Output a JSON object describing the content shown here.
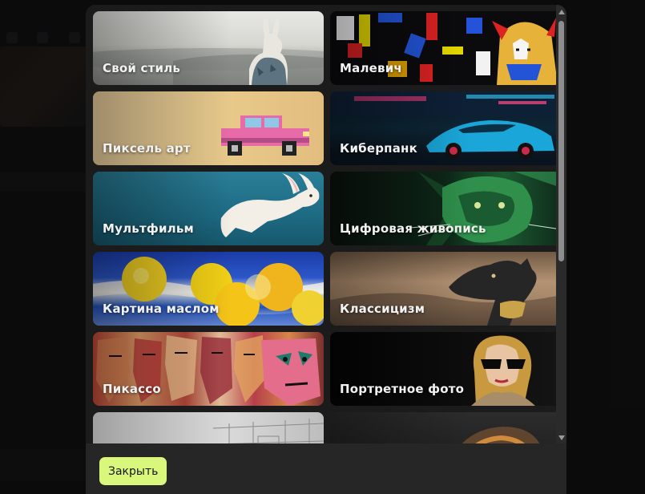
{
  "modal": {
    "styles": [
      {
        "label": "Свой стиль",
        "art": "own"
      },
      {
        "label": "Малевич",
        "art": "malevich"
      },
      {
        "label": "Пиксель арт",
        "art": "pixel"
      },
      {
        "label": "Киберпанк",
        "art": "cyber"
      },
      {
        "label": "Мультфильм",
        "art": "cartoon"
      },
      {
        "label": "Цифровая живопись",
        "art": "digital"
      },
      {
        "label": "Картина маслом",
        "art": "oil"
      },
      {
        "label": "Классицизм",
        "art": "classic"
      },
      {
        "label": "Пикассо",
        "art": "picasso"
      },
      {
        "label": "Портретное фото",
        "art": "portrait"
      },
      {
        "label": "",
        "art": "sketch"
      },
      {
        "label": "",
        "art": "dark"
      }
    ],
    "close_label": "Закрыть"
  },
  "colors": {
    "modal_bg": "#1b1b1c",
    "footer_bg": "#262627",
    "close_button_bg": "#d8f77c"
  }
}
